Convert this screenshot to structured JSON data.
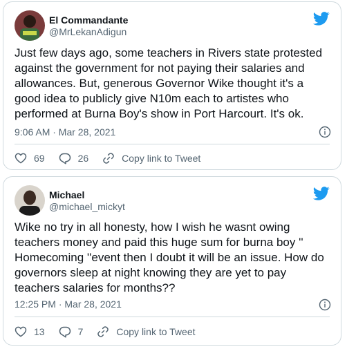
{
  "tweets": [
    {
      "author": {
        "name": "El Commandante",
        "handle": "@MrLekanAdigun"
      },
      "text": "Just few days ago, some teachers in Rivers state protested against the government for not paying their salaries and allowances. But, generous Governor Wike thought it's a good idea to publicly give N10m each to artistes who performed at Burna Boy's show in Port Harcourt. It's ok.",
      "timestamp": "9:06 AM · Mar 28, 2021",
      "likes": "69",
      "replies": "26",
      "copy_label": "Copy link to Tweet"
    },
    {
      "author": {
        "name": "Michael",
        "handle": "@michael_mickyt"
      },
      "text": "Wike no try in all honesty, how I wish he wasnt owing teachers money and paid this huge sum for burna boy '' Homecoming ''event then I doubt it will be an issue. How do governors sleep at night knowing they are yet to pay teachers salaries for months??",
      "timestamp": "12:25 PM · Mar 28, 2021",
      "likes": "13",
      "replies": "7",
      "copy_label": "Copy link to Tweet"
    }
  ],
  "colors": {
    "twitter_blue": "#1d9bf0",
    "border": "#cfd9de",
    "secondary_text": "#536471"
  },
  "icons": [
    "twitter-bird-icon",
    "info-icon",
    "heart-icon",
    "reply-icon",
    "link-icon"
  ]
}
